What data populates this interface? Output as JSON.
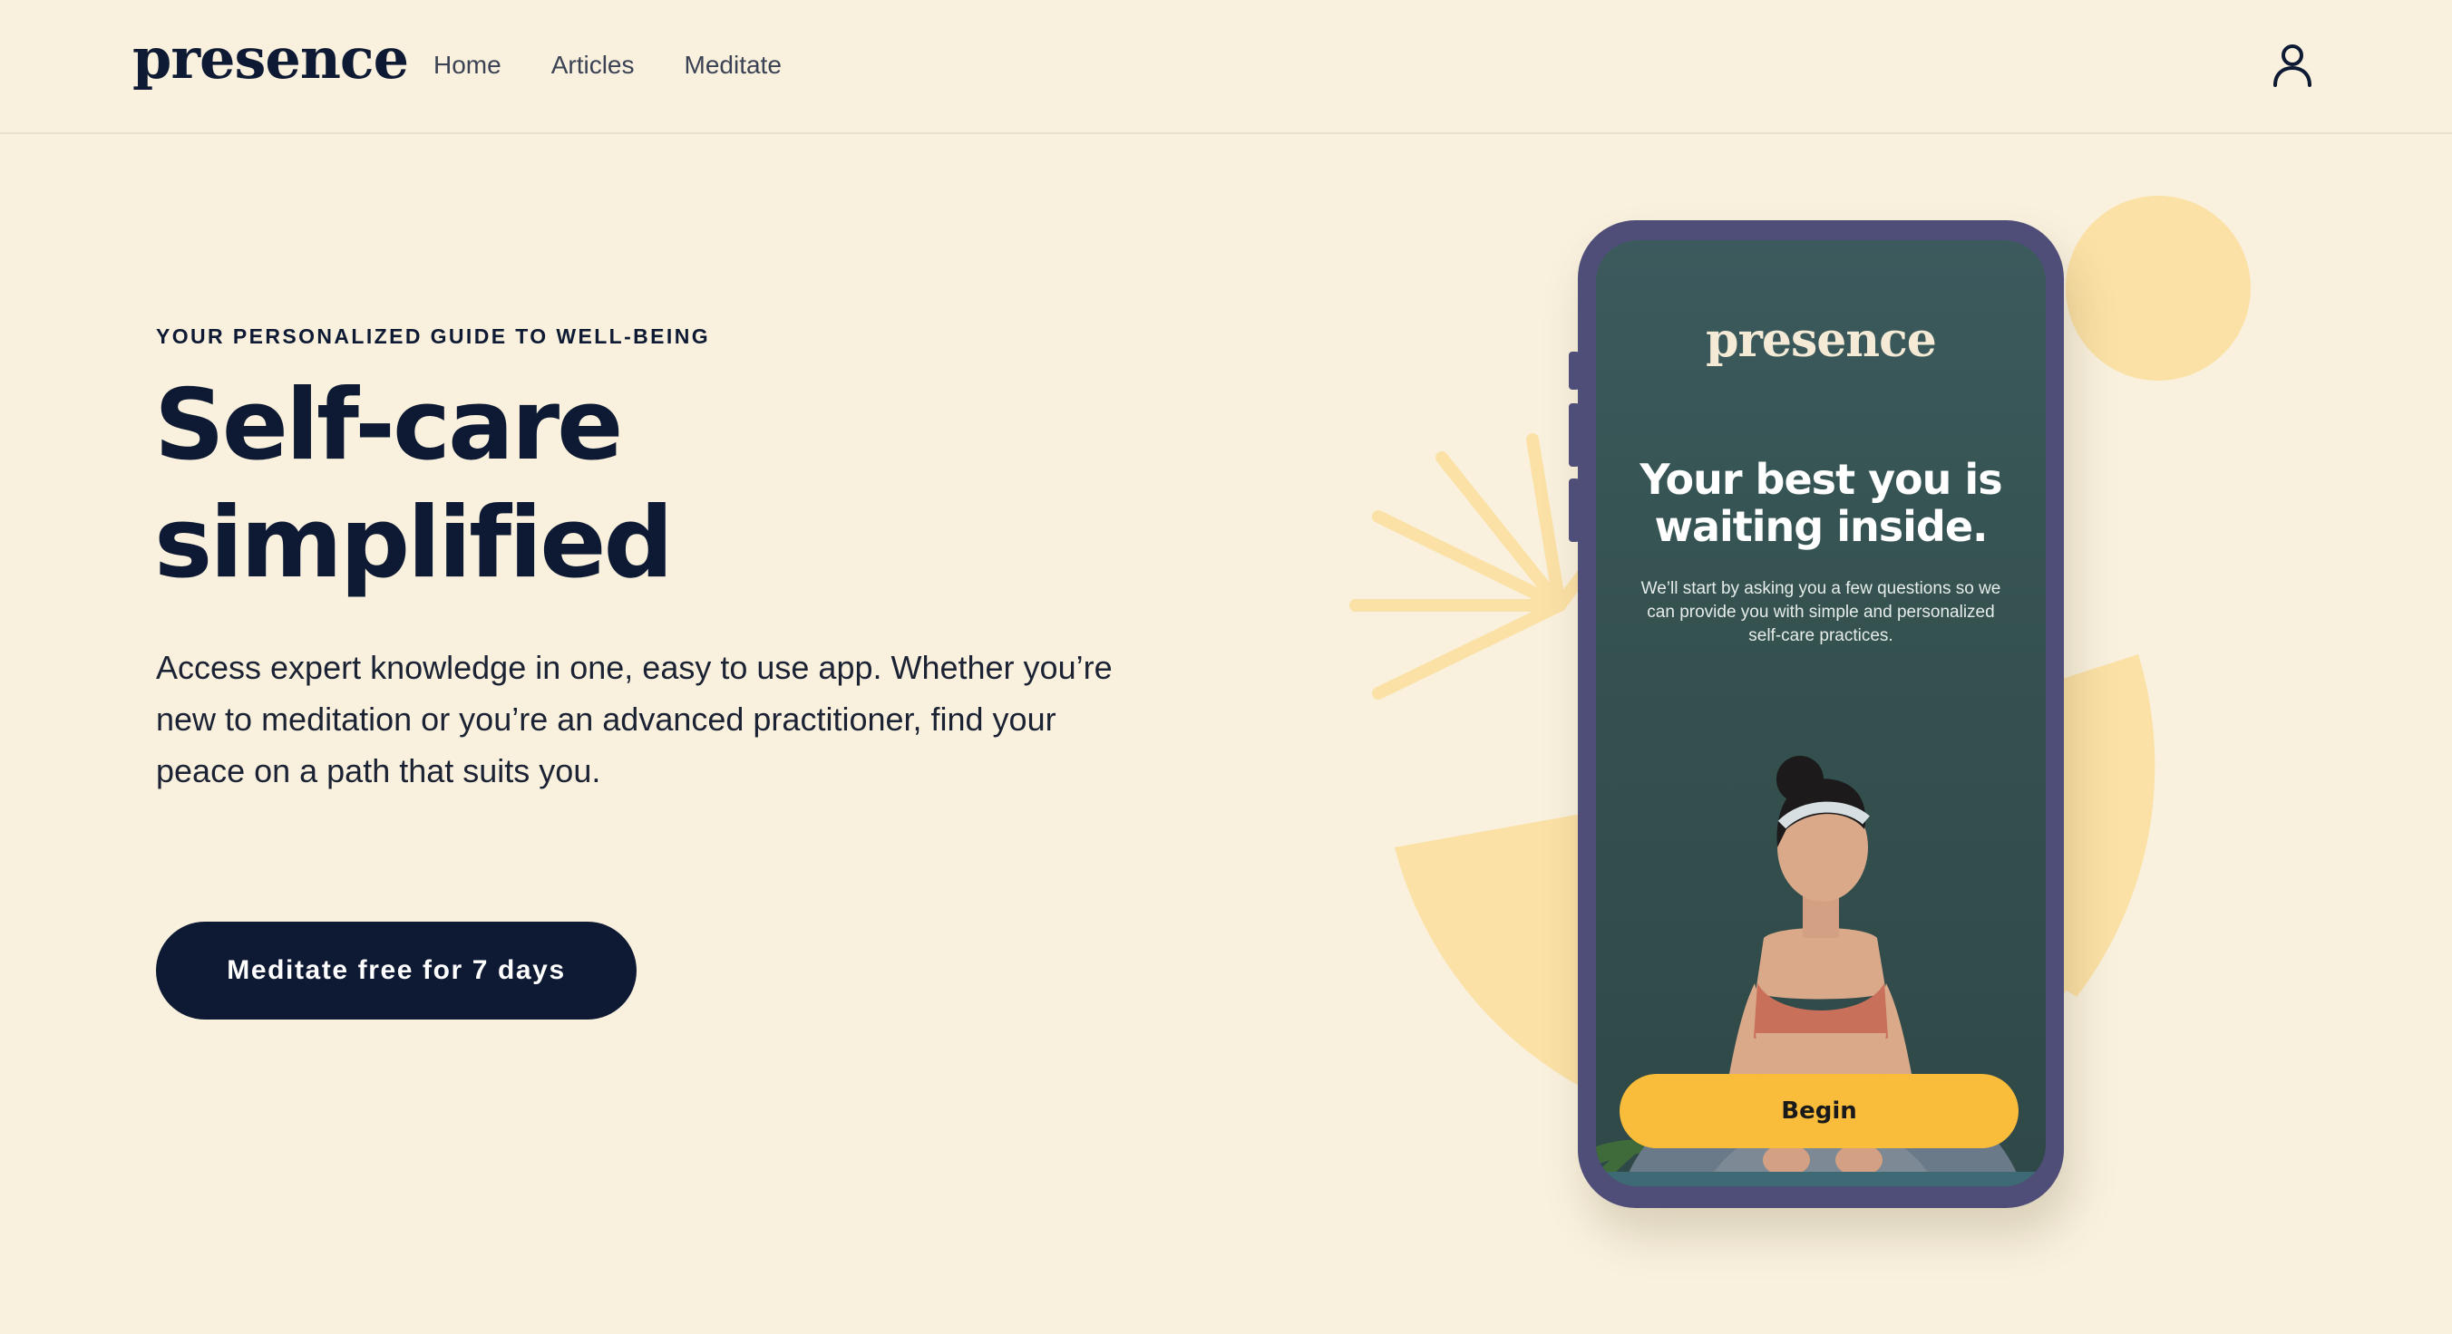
{
  "header": {
    "logo": "presence",
    "nav": [
      {
        "label": "Home"
      },
      {
        "label": "Articles"
      },
      {
        "label": "Meditate"
      }
    ],
    "account_icon": "user-icon"
  },
  "hero": {
    "eyebrow": "YOUR PERSONALIZED GUIDE TO WELL-BEING",
    "headline_line1": "Self-care",
    "headline_line2": "simplified",
    "subtext": "Access expert knowledge in one, easy to use app. Whether you’re new to meditation or you’re an advanced practitioner, find your peace on a path that suits you.",
    "cta_label": "Meditate free for 7 days"
  },
  "phone_screen": {
    "logo": "presence",
    "headline": "Your best you is waiting inside.",
    "subtext": "We’ll start by asking you a few questions so we can provide you with simple and personalized self-care practices.",
    "button_label": "Begin"
  },
  "colors": {
    "background": "#f9f1de",
    "primary": "#0e1a33",
    "accent_yellow": "#f9bd3b",
    "decor_yellow": "#fbe1a6",
    "phone_frame": "#4e4e78"
  }
}
